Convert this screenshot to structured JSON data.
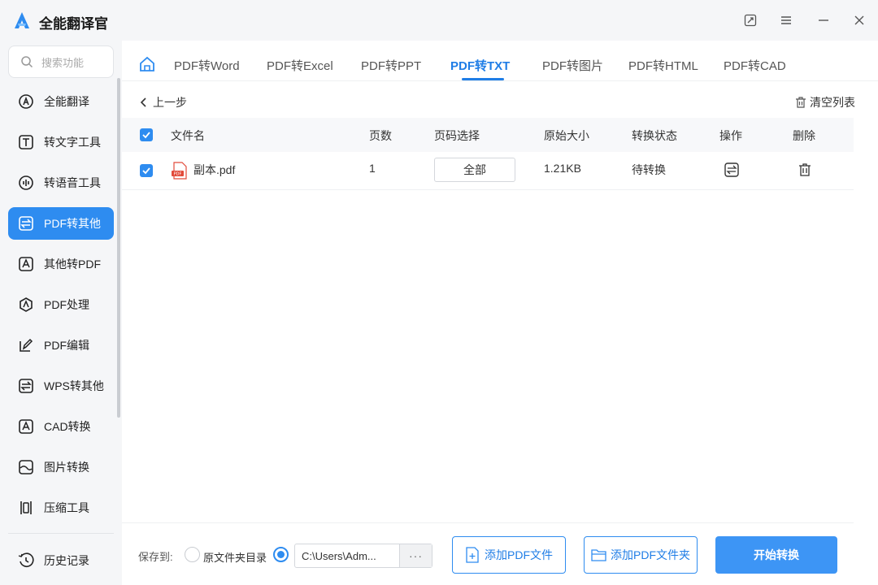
{
  "app": {
    "title": "全能翻译官",
    "accent": "#2e8cf0"
  },
  "window_controls": [
    "pin-icon",
    "menu-icon",
    "minimize-icon",
    "close-icon"
  ],
  "sidebar": {
    "search_placeholder": "搜索功能",
    "items": [
      {
        "label": "全能翻译",
        "icon": "translate-icon"
      },
      {
        "label": "转文字工具",
        "icon": "text-icon"
      },
      {
        "label": "转语音工具",
        "icon": "audio-icon"
      },
      {
        "label": "PDF转其他",
        "icon": "swap-icon",
        "active": true
      },
      {
        "label": "其他转PDF",
        "icon": "pdf-icon"
      },
      {
        "label": "PDF处理",
        "icon": "pdf-process-icon"
      },
      {
        "label": "PDF编辑",
        "icon": "edit-icon"
      },
      {
        "label": "WPS转其他",
        "icon": "wps-icon"
      },
      {
        "label": "CAD转换",
        "icon": "cad-icon"
      },
      {
        "label": "图片转换",
        "icon": "image-icon"
      },
      {
        "label": "压缩工具",
        "icon": "compress-icon"
      }
    ],
    "history": {
      "label": "历史记录",
      "icon": "history-icon"
    }
  },
  "tabs": [
    {
      "label": "PDF转Word"
    },
    {
      "label": "PDF转Excel"
    },
    {
      "label": "PDF转PPT"
    },
    {
      "label": "PDF转TXT",
      "active": true
    },
    {
      "label": "PDF转图片"
    },
    {
      "label": "PDF转HTML"
    },
    {
      "label": "PDF转CAD"
    }
  ],
  "toolbar": {
    "back_label": "上一步",
    "clear_label": "清空列表"
  },
  "table": {
    "headers": [
      "文件名",
      "页数",
      "页码选择",
      "原始大小",
      "转换状态",
      "操作",
      "删除"
    ],
    "rows": [
      {
        "name": "副本.pdf",
        "pages": "1",
        "page_select": "全部",
        "size": "1.21KB",
        "status": "待转换",
        "checked": true
      }
    ]
  },
  "bottom": {
    "save_to_label": "保存到:",
    "option_original": "原文件夹目录",
    "path": "C:\\Users\\Adm...",
    "more": "···",
    "add_file_label": "添加PDF文件",
    "add_folder_label": "添加PDF文件夹",
    "start_label": "开始转换"
  }
}
